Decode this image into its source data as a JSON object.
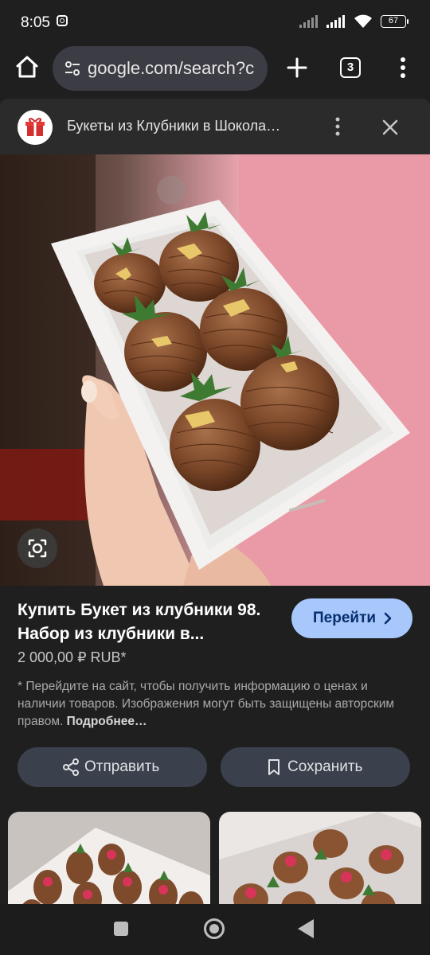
{
  "status_bar": {
    "time": "8:05",
    "battery": "67"
  },
  "browser": {
    "url": "google.com/search?c",
    "tab_count": "3"
  },
  "sheet": {
    "title": "Букеты из Клубники в Шокола…"
  },
  "product": {
    "title": "Купить Букет из клубники 98. Набор из клубники в...",
    "price": "2 000,00 ₽ RUB*",
    "visit_label": "Перейти",
    "disclaimer": "* Перейдите на сайт, чтобы получить информацию о ценах и наличии товаров. Изображения могут быть защищены авторским правом.",
    "more_link": "Подробнее…",
    "share_label": "Отправить",
    "save_label": "Сохранить"
  },
  "icons": {
    "site": "gift-icon",
    "home": "home-icon",
    "tune": "tune-icon",
    "new_tab": "plus-icon",
    "menu": "more-vert-icon",
    "close": "close-icon",
    "lens": "lens-icon",
    "share": "share-icon",
    "save": "bookmark-icon",
    "chevron": "chevron-right-icon"
  },
  "colors": {
    "accent": "#a8c7fa",
    "background": "#1f1f1f",
    "button": "#3a404c"
  }
}
